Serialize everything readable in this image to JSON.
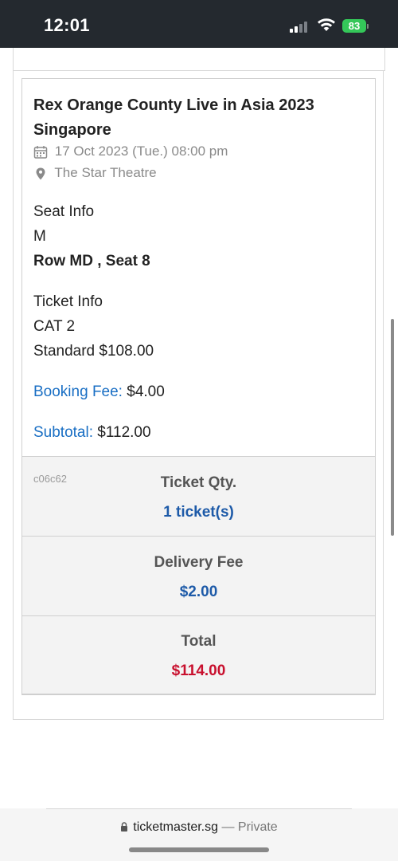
{
  "status_bar": {
    "time": "12:01",
    "battery": "83"
  },
  "event": {
    "title": "Rex Orange County Live in Asia 2023 Singapore",
    "date": "17 Oct 2023 (Tue.) 08:00 pm",
    "venue": "The Star Theatre",
    "icons": {
      "date": "calendar-icon",
      "venue": "map-pin-icon"
    }
  },
  "seat_info": {
    "label": "Seat Info",
    "section": "M",
    "row_seat": "Row MD , Seat 8"
  },
  "ticket_info": {
    "label": "Ticket Info",
    "category": "CAT 2",
    "price_line": "Standard $108.00"
  },
  "booking_fee": {
    "label": "Booking Fee:",
    "value": "$4.00"
  },
  "subtotal": {
    "label": "Subtotal:",
    "value": "$112.00"
  },
  "summary": {
    "code": "c06c62",
    "ticket_qty_label": "Ticket Qty.",
    "ticket_qty_value": "1 ticket(s)",
    "delivery_fee_label": "Delivery Fee",
    "delivery_fee_value": "$2.00",
    "total_label": "Total",
    "total_value": "$114.00"
  },
  "browser": {
    "domain": "ticketmaster.sg",
    "mode": "— Private"
  },
  "colors": {
    "accent_blue": "#1a6fc4",
    "value_blue": "#1d5aa8",
    "total_red": "#c8102e",
    "battery_green": "#34c759"
  }
}
